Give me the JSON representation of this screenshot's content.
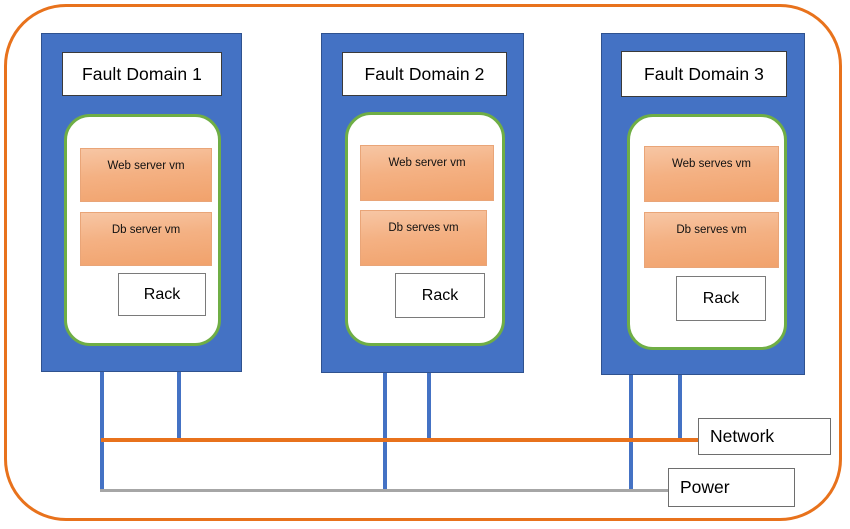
{
  "diagram": {
    "title_text_visible": false,
    "colors": {
      "frame_orange": "#E8721C",
      "card_blue": "#4472C4",
      "host_green": "#6FAE45",
      "vm_salmon": "#F4B183",
      "network_orange": "#E8721C",
      "power_gray": "#A6A6A6"
    },
    "fault_domains": [
      {
        "title": "Fault Domain 1",
        "vms": [
          {
            "label": "Web server vm"
          },
          {
            "label": "Db server vm"
          }
        ],
        "rack_label": "Rack"
      },
      {
        "title": "Fault Domain 2",
        "vms": [
          {
            "label": "Web server vm"
          },
          {
            "label": "Db serves vm"
          }
        ],
        "rack_label": "Rack"
      },
      {
        "title": "Fault Domain 3",
        "vms": [
          {
            "label": "Web serves vm"
          },
          {
            "label": "Db serves vm"
          }
        ],
        "rack_label": "Rack"
      }
    ],
    "legend": {
      "network_label": "Network",
      "power_label": "Power"
    }
  }
}
